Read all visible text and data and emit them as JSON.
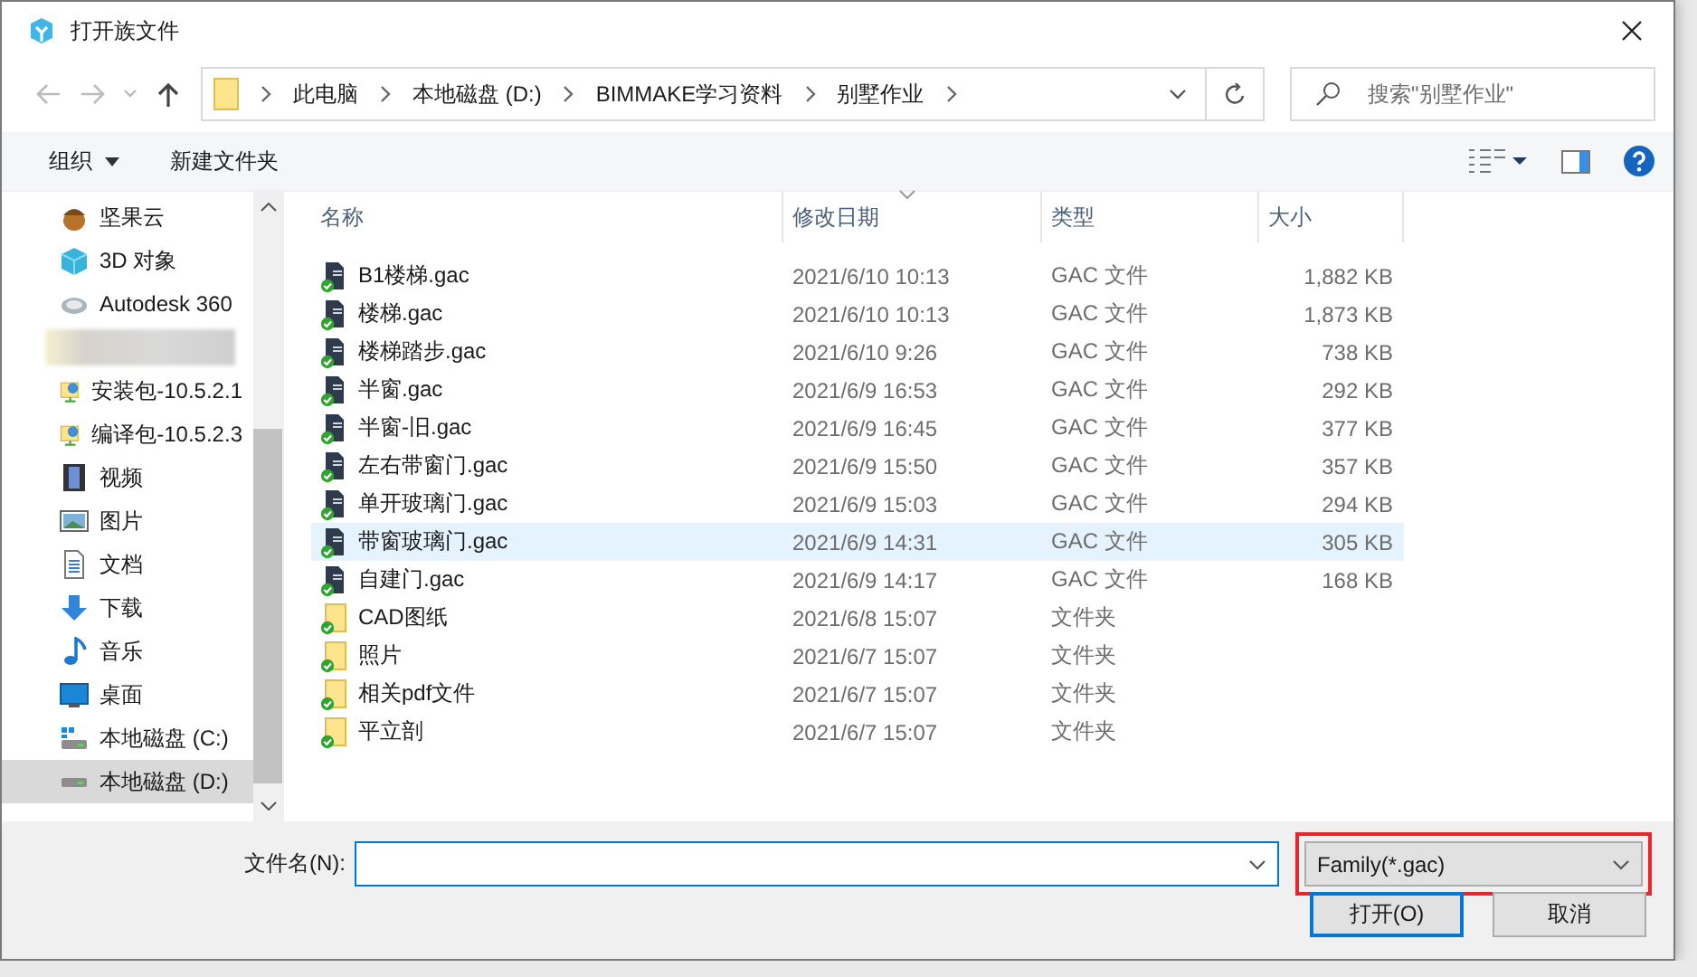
{
  "window": {
    "title": "打开族文件"
  },
  "address_bar": {
    "path": [
      "此电脑",
      "本地磁盘 (D:)",
      "BIMMAKE学习资料",
      "别墅作业"
    ]
  },
  "search": {
    "placeholder": "搜索\"别墅作业\""
  },
  "toolbar": {
    "buttons": [
      {
        "label": "组织",
        "has_menu": true
      },
      {
        "label": "新建文件夹",
        "has_menu": false
      }
    ]
  },
  "nav_pane": {
    "items": [
      {
        "kind": "nut",
        "label": "坚果云",
        "selected": false
      },
      {
        "kind": "cube",
        "label": "3D 对象",
        "selected": false
      },
      {
        "kind": "cloud",
        "label": "Autodesk 360",
        "selected": false
      },
      {
        "kind": "blurred",
        "selected": false
      },
      {
        "kind": "network",
        "label": "安装包-10.5.2.1",
        "selected": false
      },
      {
        "kind": "network",
        "label": "编译包-10.5.2.3",
        "selected": false
      },
      {
        "kind": "video",
        "label": "视频",
        "selected": false
      },
      {
        "kind": "picture",
        "label": "图片",
        "selected": false
      },
      {
        "kind": "document",
        "label": "文档",
        "selected": false
      },
      {
        "kind": "download",
        "label": "下载",
        "selected": false
      },
      {
        "kind": "music",
        "label": "音乐",
        "selected": false
      },
      {
        "kind": "desktop",
        "label": "桌面",
        "selected": false
      },
      {
        "kind": "system_drive",
        "label": "本地磁盘 (C:)",
        "selected": false
      },
      {
        "kind": "drive",
        "label": "本地磁盘 (D:)",
        "selected": true
      }
    ]
  },
  "file_list": {
    "columns": [
      {
        "label": "名称",
        "sorted": false
      },
      {
        "label": "修改日期",
        "sorted": true
      },
      {
        "label": "类型",
        "sorted": false
      },
      {
        "label": "大小",
        "sorted": false
      }
    ],
    "rows": [
      {
        "kind": "file",
        "name": "B1楼梯.gac",
        "modified": "2021/6/10 10:13",
        "type": "GAC 文件",
        "size": "1,882 KB",
        "selected": false
      },
      {
        "kind": "file",
        "name": "楼梯.gac",
        "modified": "2021/6/10 10:13",
        "type": "GAC 文件",
        "size": "1,873 KB",
        "selected": false
      },
      {
        "kind": "file",
        "name": "楼梯踏步.gac",
        "modified": "2021/6/10 9:26",
        "type": "GAC 文件",
        "size": "738 KB",
        "selected": false
      },
      {
        "kind": "file",
        "name": "半窗.gac",
        "modified": "2021/6/9 16:53",
        "type": "GAC 文件",
        "size": "292 KB",
        "selected": false
      },
      {
        "kind": "file",
        "name": "半窗-旧.gac",
        "modified": "2021/6/9 16:45",
        "type": "GAC 文件",
        "size": "377 KB",
        "selected": false
      },
      {
        "kind": "file",
        "name": "左右带窗门.gac",
        "modified": "2021/6/9 15:50",
        "type": "GAC 文件",
        "size": "357 KB",
        "selected": false
      },
      {
        "kind": "file",
        "name": "单开玻璃门.gac",
        "modified": "2021/6/9 15:03",
        "type": "GAC 文件",
        "size": "294 KB",
        "selected": false
      },
      {
        "kind": "file",
        "name": "带窗玻璃门.gac",
        "modified": "2021/6/9 14:31",
        "type": "GAC 文件",
        "size": "305 KB",
        "selected": true
      },
      {
        "kind": "file",
        "name": "自建门.gac",
        "modified": "2021/6/9 14:17",
        "type": "GAC 文件",
        "size": "168 KB",
        "selected": false
      },
      {
        "kind": "folder",
        "name": "CAD图纸",
        "modified": "2021/6/8 15:07",
        "type": "文件夹",
        "selected": false
      },
      {
        "kind": "folder",
        "name": "照片",
        "modified": "2021/6/7 15:07",
        "type": "文件夹",
        "selected": false
      },
      {
        "kind": "folder",
        "name": "相关pdf文件",
        "modified": "2021/6/7 15:07",
        "type": "文件夹",
        "selected": false
      },
      {
        "kind": "folder",
        "name": "平立剖",
        "modified": "2021/6/7 15:07",
        "type": "文件夹",
        "selected": false
      }
    ]
  },
  "footer": {
    "filename_label": "文件名(N):",
    "file_type": {
      "value": "Family(*.gac)",
      "highlighted": true
    },
    "buttons": [
      {
        "label": "打开(O)",
        "default": true
      },
      {
        "label": "取消",
        "default": false
      }
    ]
  }
}
